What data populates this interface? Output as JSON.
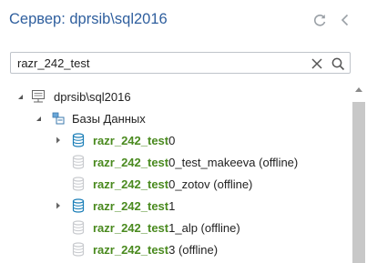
{
  "header": {
    "title": "Сервер: dprsib\\sql2016",
    "refresh_icon": "refresh-icon",
    "collapse_icon": "chevron-left-icon"
  },
  "search": {
    "value": "razr_242_test",
    "clear_icon": "close-icon",
    "search_icon": "search-icon"
  },
  "tree": {
    "server": {
      "label": "dprsib\\sql2016",
      "icon": "server-icon",
      "expanded": true
    },
    "databases_folder": {
      "label": "Базы Данных",
      "icon": "databases-folder-icon",
      "expanded": true
    },
    "items": [
      {
        "match": "razr_242_test",
        "rest": "0",
        "status": "online",
        "expandable": true
      },
      {
        "match": "razr_242_test",
        "rest": "0_test_makeeva (offline)",
        "status": "offline",
        "expandable": false
      },
      {
        "match": "razr_242_test",
        "rest": "0_zotov (offline)",
        "status": "offline",
        "expandable": false
      },
      {
        "match": "razr_242_test",
        "rest": "1",
        "status": "online",
        "expandable": true
      },
      {
        "match": "razr_242_test",
        "rest": "1_alp (offline)",
        "status": "offline",
        "expandable": false
      },
      {
        "match": "razr_242_test",
        "rest": "3 (offline)",
        "status": "offline",
        "expandable": false
      }
    ]
  },
  "colors": {
    "title": "#2f5f9e",
    "match": "#4a8a1f",
    "db_online": "#1c7fb8",
    "db_offline": "#c9cbcf"
  }
}
